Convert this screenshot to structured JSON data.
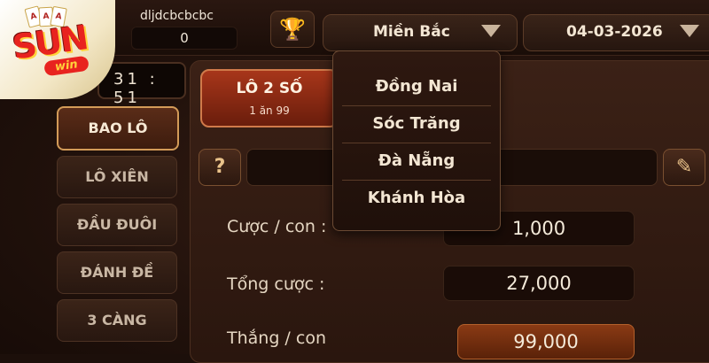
{
  "user": {
    "username": "dljdcbcbcbc",
    "balance": "0"
  },
  "header": {
    "region_select": "Miền Bắc",
    "date_select": "04-03-2026"
  },
  "logo": {
    "text": "SUN",
    "sub": "win"
  },
  "timer": "31 : 51",
  "sidebar": {
    "items": [
      {
        "label": "BAO LÔ",
        "active": true
      },
      {
        "label": "LÔ XIÊN",
        "active": false
      },
      {
        "label": "ĐẦU ĐUÔI",
        "active": false
      },
      {
        "label": "ĐÁNH ĐỀ",
        "active": false
      },
      {
        "label": "3 CÀNG",
        "active": false
      }
    ]
  },
  "bet_type_tab": {
    "title": "LÔ 2 SỐ",
    "odds": "1 ăn 99"
  },
  "help_label": "?",
  "rows": {
    "bet_per_number": {
      "label": "Cược / con :",
      "value": "1,000"
    },
    "total_bet": {
      "label": "Tổng cược :",
      "value": "27,000"
    },
    "win_per_number": {
      "label": "Thắng / con",
      "value": "99,000"
    }
  },
  "dropdown": {
    "options": [
      "Đồng Nai",
      "Sóc Trăng",
      "Đà Nẵng",
      "Khánh Hòa"
    ]
  },
  "icons": {
    "trophy": "trophy-icon",
    "edit": "pencil-icon",
    "select_arrow": "chevron-down-icon"
  },
  "colors": {
    "active_tab": "#a8361a",
    "accent_gold": "#d39b58",
    "trophy": "#ffcf3a"
  }
}
